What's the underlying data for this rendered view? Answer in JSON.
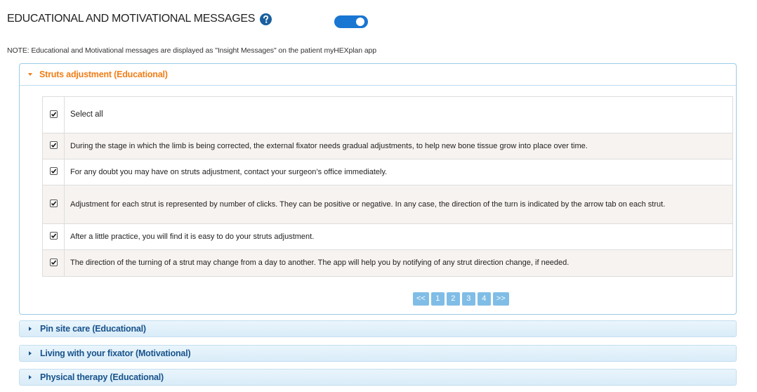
{
  "header": {
    "title": "EDUCATIONAL AND MOTIVATIONAL MESSAGES",
    "help_icon": "question-circle-icon",
    "toggle_state": "on",
    "accent_color": "#1976d2"
  },
  "note": "NOTE: Educational and Motivational messages are displayed as \"Insight Messages\" on the patient myHEXplan app",
  "open_panel": {
    "title": "Struts adjustment (Educational)",
    "title_color": "#f07e17",
    "select_all_label": "Select all",
    "messages": [
      "During the stage in which the limb is being corrected, the external fixator needs gradual adjustments, to help new bone tissue grow into place over time.",
      "For any doubt you may have on struts adjustment, contact your surgeon’s office immediately.",
      "Adjustment for each strut is represented by number of clicks. They can be positive or negative. In any case, the direction of the turn is indicated by the arrow tab on each strut.",
      "After a little practice, you will find it is easy to do your struts adjustment.",
      "The direction of the turning of a strut may change from a day to another. The app will help you by notifying of any strut direction change, if needed."
    ],
    "pagination": [
      "<<",
      "1",
      "2",
      "3",
      "4",
      ">>"
    ]
  },
  "sections": [
    "Pin site care (Educational)",
    "Living with your fixator (Motivational)",
    "Physical therapy (Educational)"
  ]
}
